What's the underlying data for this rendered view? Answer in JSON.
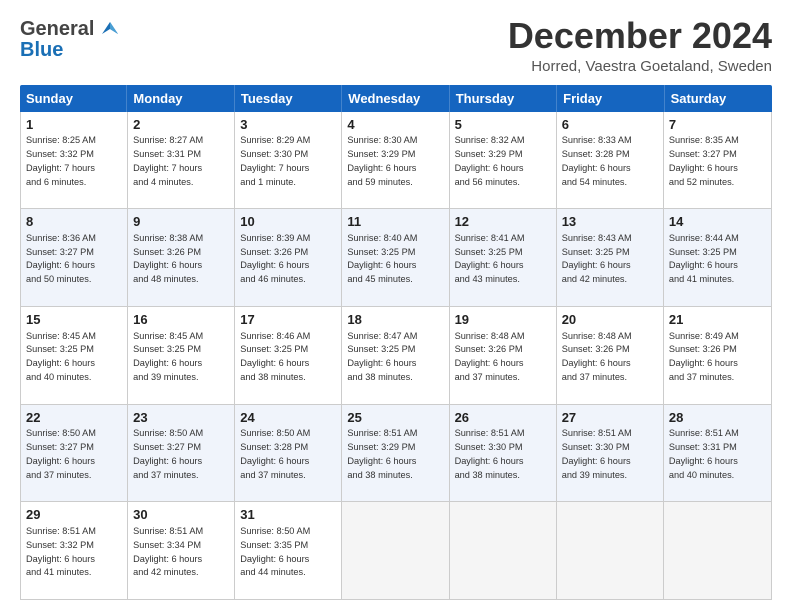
{
  "header": {
    "logo_general": "General",
    "logo_blue": "Blue",
    "title": "December 2024",
    "location": "Horred, Vaestra Goetaland, Sweden"
  },
  "days": [
    "Sunday",
    "Monday",
    "Tuesday",
    "Wednesday",
    "Thursday",
    "Friday",
    "Saturday"
  ],
  "weeks": [
    {
      "alt": false,
      "cells": [
        {
          "day": "1",
          "text": "Sunrise: 8:25 AM\nSunset: 3:32 PM\nDaylight: 7 hours\nand 6 minutes."
        },
        {
          "day": "2",
          "text": "Sunrise: 8:27 AM\nSunset: 3:31 PM\nDaylight: 7 hours\nand 4 minutes."
        },
        {
          "day": "3",
          "text": "Sunrise: 8:29 AM\nSunset: 3:30 PM\nDaylight: 7 hours\nand 1 minute."
        },
        {
          "day": "4",
          "text": "Sunrise: 8:30 AM\nSunset: 3:29 PM\nDaylight: 6 hours\nand 59 minutes."
        },
        {
          "day": "5",
          "text": "Sunrise: 8:32 AM\nSunset: 3:29 PM\nDaylight: 6 hours\nand 56 minutes."
        },
        {
          "day": "6",
          "text": "Sunrise: 8:33 AM\nSunset: 3:28 PM\nDaylight: 6 hours\nand 54 minutes."
        },
        {
          "day": "7",
          "text": "Sunrise: 8:35 AM\nSunset: 3:27 PM\nDaylight: 6 hours\nand 52 minutes."
        }
      ]
    },
    {
      "alt": true,
      "cells": [
        {
          "day": "8",
          "text": "Sunrise: 8:36 AM\nSunset: 3:27 PM\nDaylight: 6 hours\nand 50 minutes."
        },
        {
          "day": "9",
          "text": "Sunrise: 8:38 AM\nSunset: 3:26 PM\nDaylight: 6 hours\nand 48 minutes."
        },
        {
          "day": "10",
          "text": "Sunrise: 8:39 AM\nSunset: 3:26 PM\nDaylight: 6 hours\nand 46 minutes."
        },
        {
          "day": "11",
          "text": "Sunrise: 8:40 AM\nSunset: 3:25 PM\nDaylight: 6 hours\nand 45 minutes."
        },
        {
          "day": "12",
          "text": "Sunrise: 8:41 AM\nSunset: 3:25 PM\nDaylight: 6 hours\nand 43 minutes."
        },
        {
          "day": "13",
          "text": "Sunrise: 8:43 AM\nSunset: 3:25 PM\nDaylight: 6 hours\nand 42 minutes."
        },
        {
          "day": "14",
          "text": "Sunrise: 8:44 AM\nSunset: 3:25 PM\nDaylight: 6 hours\nand 41 minutes."
        }
      ]
    },
    {
      "alt": false,
      "cells": [
        {
          "day": "15",
          "text": "Sunrise: 8:45 AM\nSunset: 3:25 PM\nDaylight: 6 hours\nand 40 minutes."
        },
        {
          "day": "16",
          "text": "Sunrise: 8:45 AM\nSunset: 3:25 PM\nDaylight: 6 hours\nand 39 minutes."
        },
        {
          "day": "17",
          "text": "Sunrise: 8:46 AM\nSunset: 3:25 PM\nDaylight: 6 hours\nand 38 minutes."
        },
        {
          "day": "18",
          "text": "Sunrise: 8:47 AM\nSunset: 3:25 PM\nDaylight: 6 hours\nand 38 minutes."
        },
        {
          "day": "19",
          "text": "Sunrise: 8:48 AM\nSunset: 3:26 PM\nDaylight: 6 hours\nand 37 minutes."
        },
        {
          "day": "20",
          "text": "Sunrise: 8:48 AM\nSunset: 3:26 PM\nDaylight: 6 hours\nand 37 minutes."
        },
        {
          "day": "21",
          "text": "Sunrise: 8:49 AM\nSunset: 3:26 PM\nDaylight: 6 hours\nand 37 minutes."
        }
      ]
    },
    {
      "alt": true,
      "cells": [
        {
          "day": "22",
          "text": "Sunrise: 8:50 AM\nSunset: 3:27 PM\nDaylight: 6 hours\nand 37 minutes."
        },
        {
          "day": "23",
          "text": "Sunrise: 8:50 AM\nSunset: 3:27 PM\nDaylight: 6 hours\nand 37 minutes."
        },
        {
          "day": "24",
          "text": "Sunrise: 8:50 AM\nSunset: 3:28 PM\nDaylight: 6 hours\nand 37 minutes."
        },
        {
          "day": "25",
          "text": "Sunrise: 8:51 AM\nSunset: 3:29 PM\nDaylight: 6 hours\nand 38 minutes."
        },
        {
          "day": "26",
          "text": "Sunrise: 8:51 AM\nSunset: 3:30 PM\nDaylight: 6 hours\nand 38 minutes."
        },
        {
          "day": "27",
          "text": "Sunrise: 8:51 AM\nSunset: 3:30 PM\nDaylight: 6 hours\nand 39 minutes."
        },
        {
          "day": "28",
          "text": "Sunrise: 8:51 AM\nSunset: 3:31 PM\nDaylight: 6 hours\nand 40 minutes."
        }
      ]
    },
    {
      "alt": false,
      "cells": [
        {
          "day": "29",
          "text": "Sunrise: 8:51 AM\nSunset: 3:32 PM\nDaylight: 6 hours\nand 41 minutes."
        },
        {
          "day": "30",
          "text": "Sunrise: 8:51 AM\nSunset: 3:34 PM\nDaylight: 6 hours\nand 42 minutes."
        },
        {
          "day": "31",
          "text": "Sunrise: 8:50 AM\nSunset: 3:35 PM\nDaylight: 6 hours\nand 44 minutes."
        },
        {
          "day": "",
          "text": ""
        },
        {
          "day": "",
          "text": ""
        },
        {
          "day": "",
          "text": ""
        },
        {
          "day": "",
          "text": ""
        }
      ]
    }
  ]
}
